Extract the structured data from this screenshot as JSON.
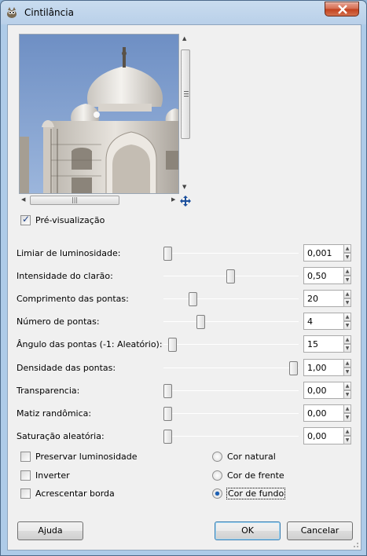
{
  "window": {
    "title": "Cintilância"
  },
  "preview": {
    "checkbox_label": "Pré-visualização",
    "checked": true
  },
  "sliders": [
    {
      "label": "Limiar de luminosidade:",
      "value": "0,001",
      "level": 0.0
    },
    {
      "label": "Intensidade do clarão:",
      "value": "0,50",
      "level": 0.5
    },
    {
      "label": "Comprimento das pontas:",
      "value": "20",
      "level": 0.2
    },
    {
      "label": "Número de pontas:",
      "value": "4",
      "level": 0.26
    },
    {
      "label": "Ângulo das pontas (-1: Aleatório):",
      "value": "15",
      "level": 0.04
    },
    {
      "label": "Densidade das pontas:",
      "value": "1,00",
      "level": 1.0
    },
    {
      "label": "Transparencia:",
      "value": "0,00",
      "level": 0.0
    },
    {
      "label": "Matiz randômica:",
      "value": "0,00",
      "level": 0.0
    },
    {
      "label": "Saturação aleatória:",
      "value": "0,00",
      "level": 0.0
    }
  ],
  "options": {
    "checkboxes": [
      {
        "label": "Preservar luminosidade",
        "checked": false
      },
      {
        "label": "Inverter",
        "checked": false
      },
      {
        "label": "Acrescentar borda",
        "checked": false
      }
    ],
    "radios": [
      {
        "label": "Cor natural",
        "checked": false
      },
      {
        "label": "Cor de frente",
        "checked": false
      },
      {
        "label": "Cor de fundo",
        "checked": true
      }
    ]
  },
  "buttons": {
    "help": "Ajuda",
    "ok": "OK",
    "cancel": "Cancelar"
  }
}
